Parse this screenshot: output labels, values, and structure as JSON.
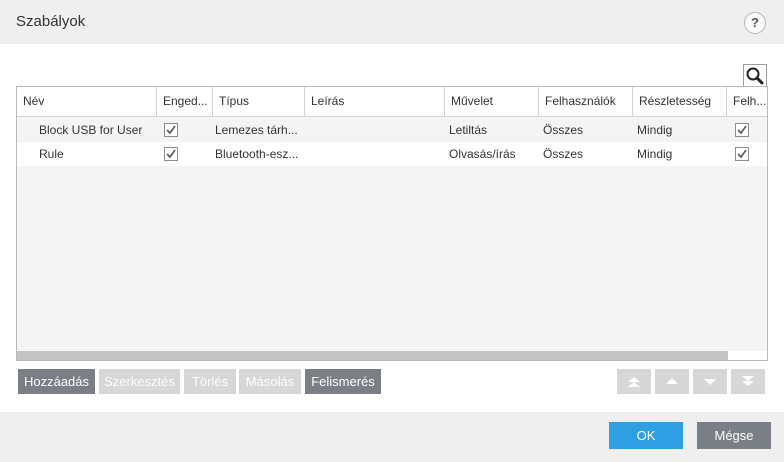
{
  "dialog": {
    "title": "Szabályok",
    "help_symbol": "?"
  },
  "table": {
    "columns": [
      "Név",
      "Enged...",
      "Típus",
      "Leírás",
      "Művelet",
      "Felhasználók",
      "Részletesség",
      "Felh..."
    ],
    "rows": [
      {
        "name": "Block USB for User",
        "enabled": true,
        "type": "Lemezes tárh...",
        "description": "",
        "action": "Letiltás",
        "users": "Összes",
        "severity": "Mindig",
        "notify": true
      },
      {
        "name": "Rule",
        "enabled": true,
        "type": "Bluetooth-esz...",
        "description": "",
        "action": "Olvasás/írás",
        "users": "Összes",
        "severity": "Mindig",
        "notify": true
      }
    ]
  },
  "buttons": {
    "add": "Hozzáadás",
    "edit": "Szerkesztés",
    "delete": "Törlés",
    "copy": "Másolás",
    "detect": "Felismerés"
  },
  "footer": {
    "ok": "OK",
    "cancel": "Mégse"
  },
  "icons": {
    "search": "search-icon",
    "move_top": "double-arrow-up-icon",
    "move_up": "arrow-up-icon",
    "move_down": "arrow-down-icon",
    "move_bottom": "double-arrow-down-icon"
  },
  "colors": {
    "primary": "#2f9fe4",
    "button_dark": "#7a7f85",
    "button_disabled": "#d7d7d7"
  }
}
